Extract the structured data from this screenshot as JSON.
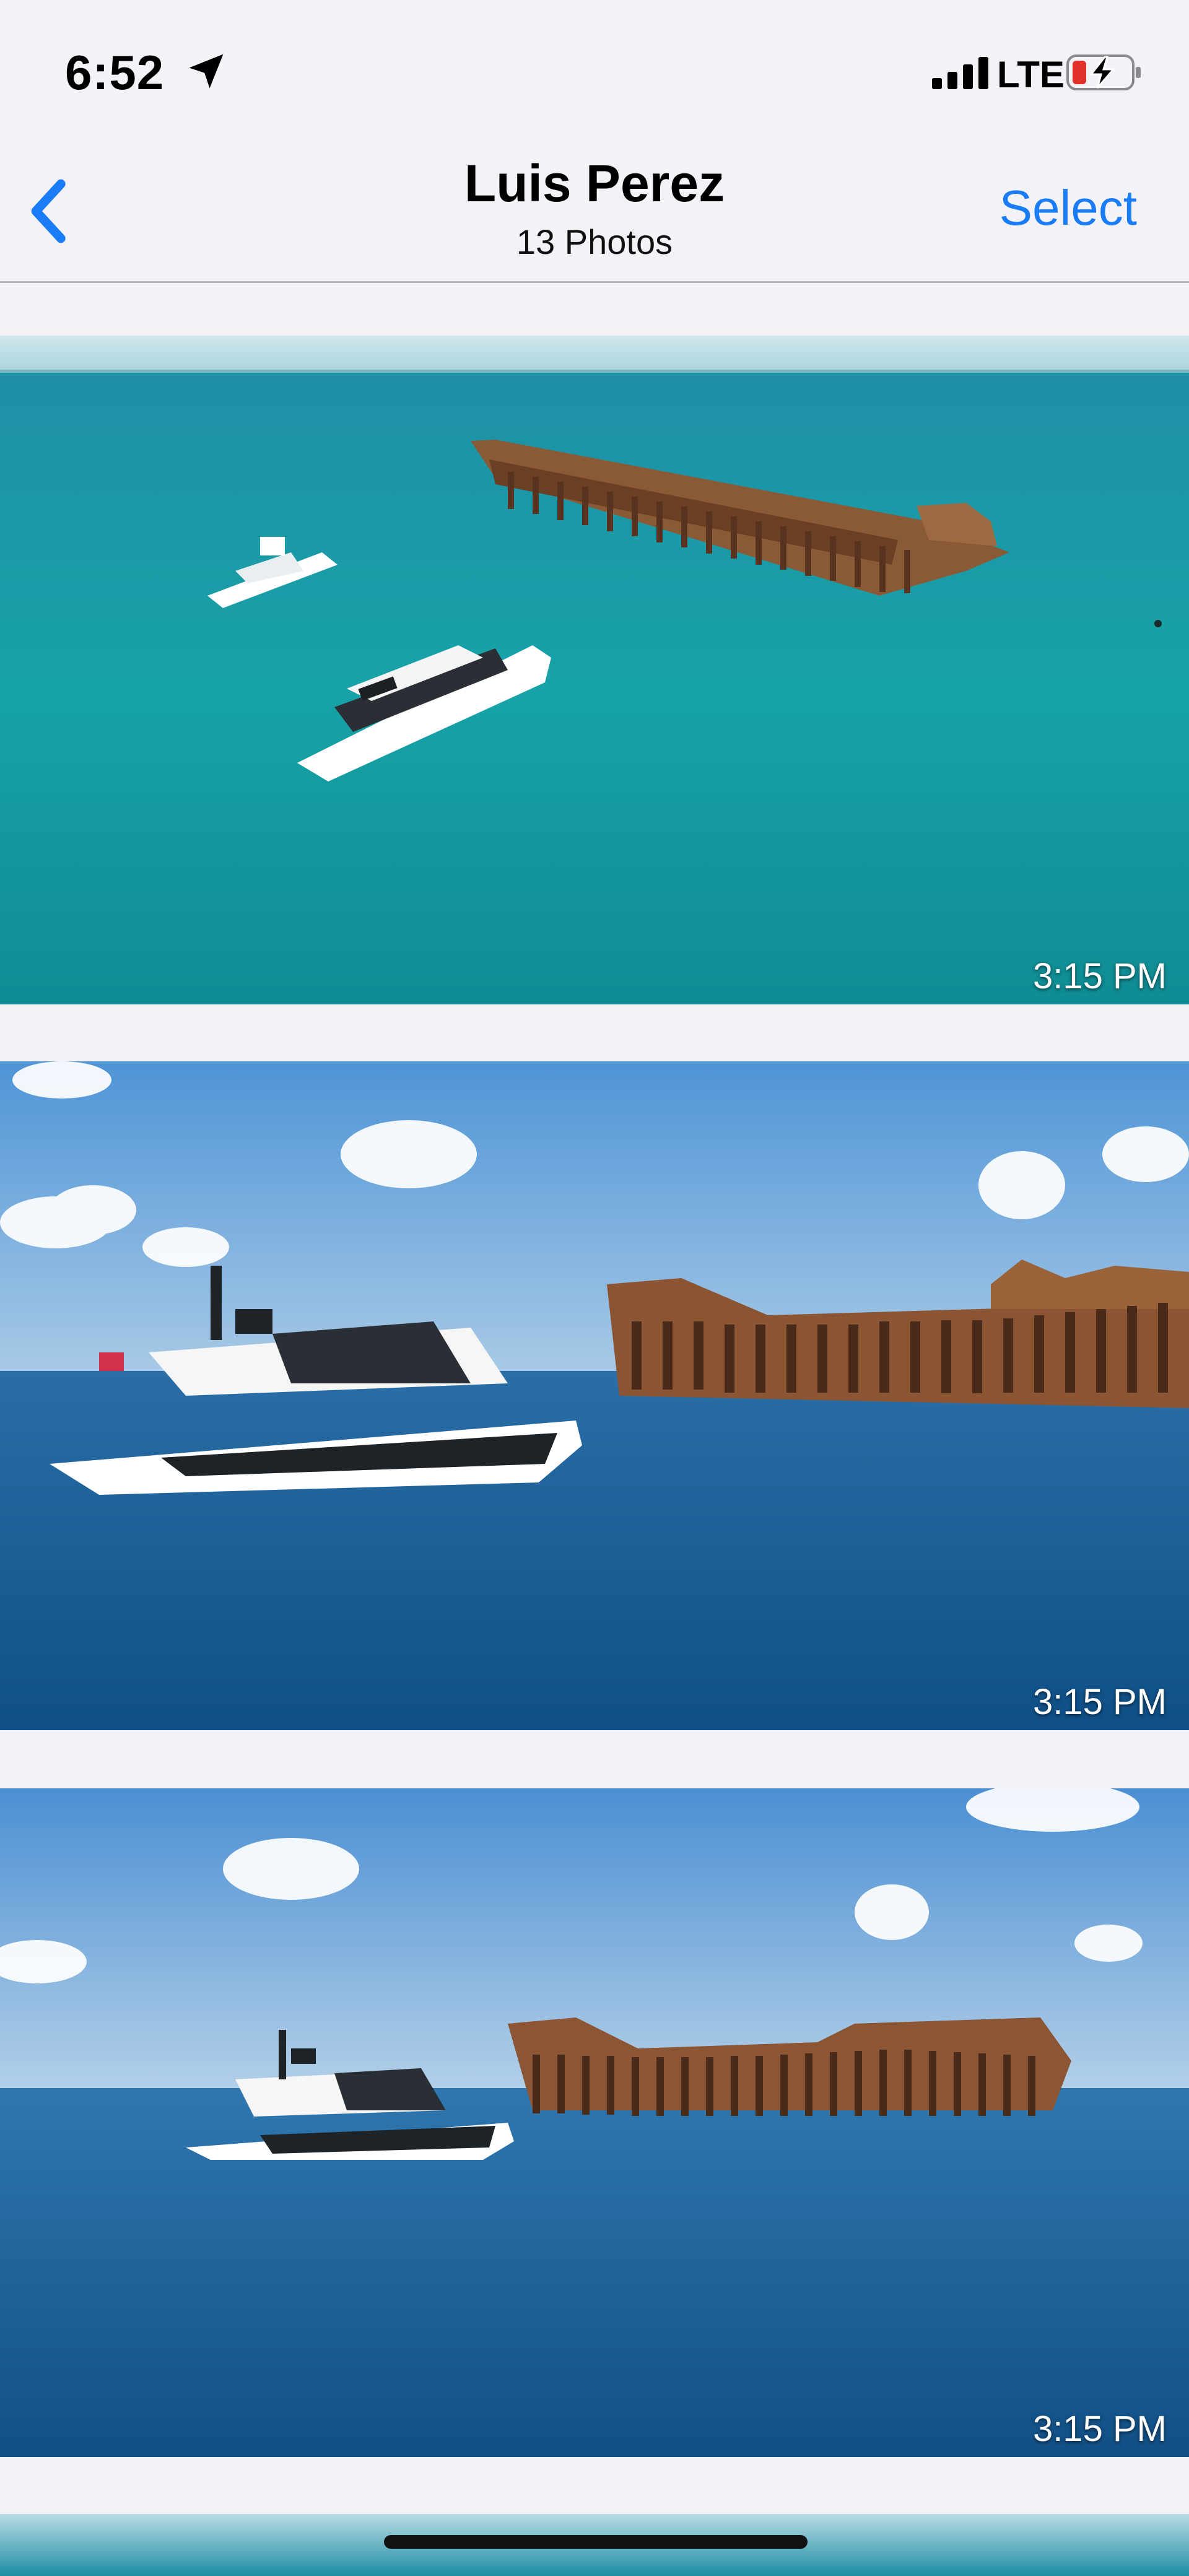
{
  "status_bar": {
    "time": "6:52",
    "network": "LTE",
    "icons": [
      "location-arrow-icon",
      "signal-bars-icon",
      "battery-charging-icon"
    ]
  },
  "nav": {
    "back_icon": "chevron-left-icon",
    "title": "Luis Perez",
    "subtitle": "13 Photos",
    "select_label": "Select",
    "accent_color": "#1a7cf6"
  },
  "photos": [
    {
      "timestamp": "3:15 PM"
    },
    {
      "timestamp": "3:15 PM"
    },
    {
      "timestamp": "3:15 PM"
    }
  ]
}
